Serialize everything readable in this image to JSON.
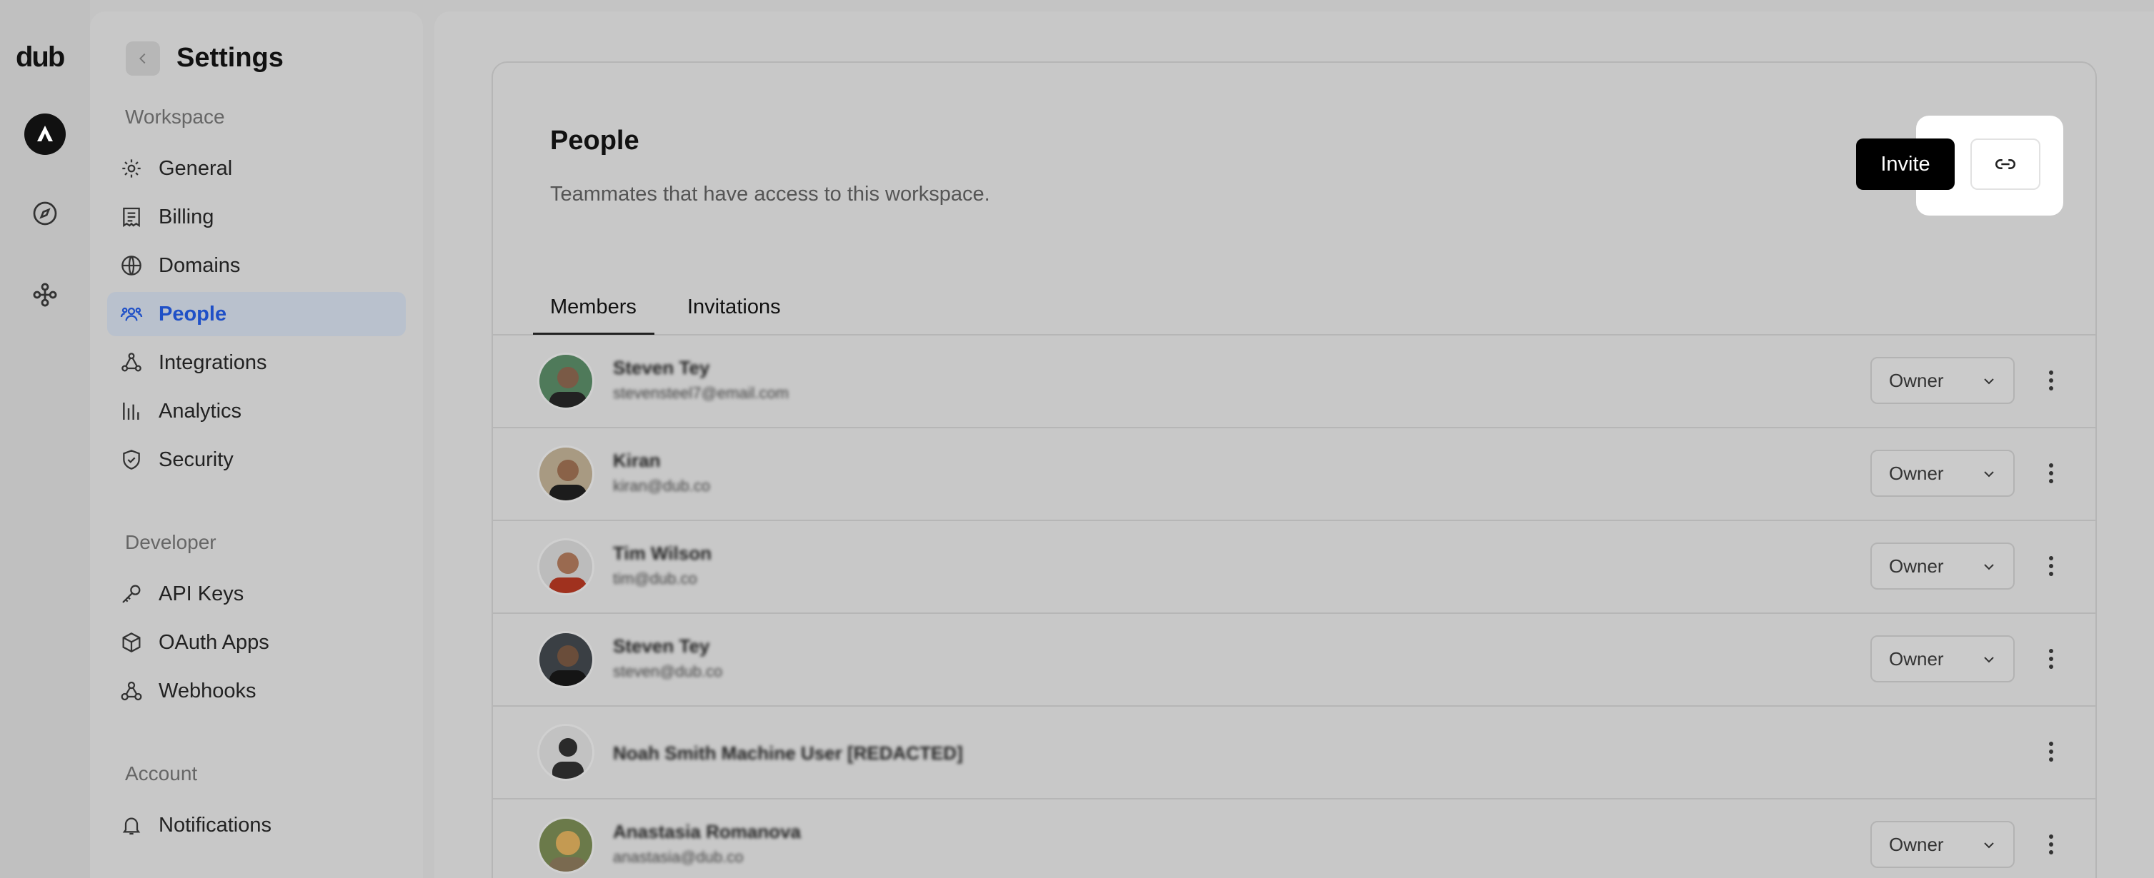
{
  "app": {
    "logo_text": "dub"
  },
  "rail": {
    "icons": [
      "workspace-avatar-icon",
      "compass-icon",
      "integrations-network-icon"
    ]
  },
  "sidebar": {
    "title": "Settings",
    "sections": {
      "workspace": "Workspace",
      "developer": "Developer",
      "account": "Account"
    },
    "workspace_items": [
      {
        "label": "General",
        "icon": "gear-icon"
      },
      {
        "label": "Billing",
        "icon": "receipt-icon"
      },
      {
        "label": "Domains",
        "icon": "globe-icon"
      },
      {
        "label": "People",
        "icon": "users-icon",
        "active": true
      },
      {
        "label": "Integrations",
        "icon": "integrations-icon"
      },
      {
        "label": "Analytics",
        "icon": "analytics-icon"
      },
      {
        "label": "Security",
        "icon": "shield-icon"
      }
    ],
    "developer_items": [
      {
        "label": "API Keys",
        "icon": "key-icon"
      },
      {
        "label": "OAuth Apps",
        "icon": "cube-icon"
      },
      {
        "label": "Webhooks",
        "icon": "webhook-icon"
      }
    ],
    "account_items": [
      {
        "label": "Notifications",
        "icon": "bell-icon"
      }
    ]
  },
  "main": {
    "title": "People",
    "subtitle": "Teammates that have access to this workspace.",
    "invite_label": "Invite",
    "tabs": [
      {
        "label": "Members",
        "active": true
      },
      {
        "label": "Invitations"
      }
    ],
    "members": [
      {
        "name": "Steven Tey",
        "email": "stevensteel7@email.com",
        "role": "Owner"
      },
      {
        "name": "Kiran",
        "email": "kiran@dub.co",
        "role": "Owner"
      },
      {
        "name": "Tim Wilson",
        "email": "tim@dub.co",
        "role": "Owner"
      },
      {
        "name": "Steven Tey",
        "email": "steven@dub.co",
        "role": "Owner"
      },
      {
        "name": "Noah Smith Machine User [REDACTED]",
        "email": "",
        "role": ""
      },
      {
        "name": "Anastasia Romanova",
        "email": "anastasia@dub.co",
        "role": "Owner"
      }
    ]
  }
}
